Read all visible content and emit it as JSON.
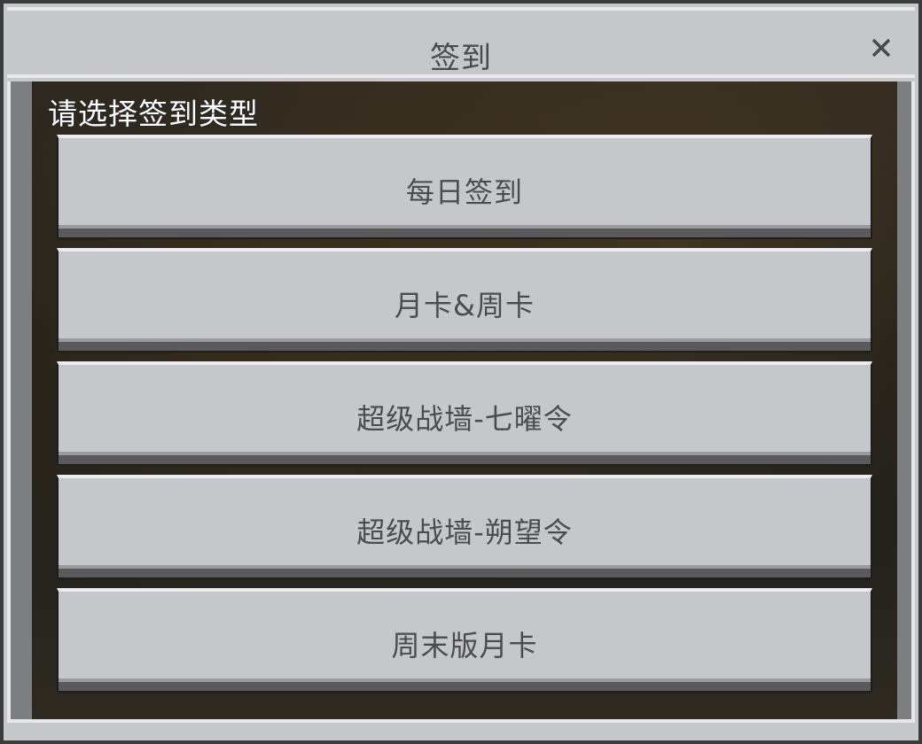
{
  "dialog": {
    "title": "签到",
    "close_icon": "close-icon"
  },
  "prompt": "请选择签到类型",
  "buttons": [
    {
      "label": "每日签到"
    },
    {
      "label": "月卡&周卡"
    },
    {
      "label": "超级战墙-七曜令"
    },
    {
      "label": "超级战墙-朔望令"
    },
    {
      "label": "周末版月卡"
    }
  ],
  "colors": {
    "button_face": "#c6c7cb",
    "button_text": "#4c4c4f",
    "prompt_text": "#ffffff"
  }
}
